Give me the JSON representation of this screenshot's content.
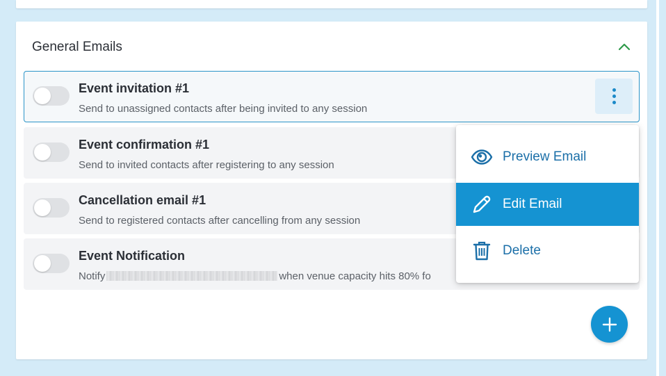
{
  "section": {
    "title": "General Emails"
  },
  "emails": [
    {
      "title": "Event invitation #1",
      "description": "Send to unassigned contacts after being invited to any session",
      "enabled": false
    },
    {
      "title": "Event confirmation #1",
      "description": "Send to invited contacts after registering to any session",
      "enabled": false
    },
    {
      "title": "Cancellation email #1",
      "description": "Send to registered contacts after cancelling from any session",
      "enabled": false
    },
    {
      "title": "Event Notification",
      "description_prefix": "Notify",
      "description_suffix": "when venue capacity hits 80% fo",
      "enabled": false
    }
  ],
  "menu": {
    "items": [
      {
        "label": "Preview Email",
        "icon": "eye-icon"
      },
      {
        "label": "Edit Email",
        "icon": "pencil-icon",
        "active": true
      },
      {
        "label": "Delete",
        "icon": "trash-icon"
      }
    ]
  },
  "icons": {
    "collapse": "chevron-up-icon",
    "row_menu": "kebab-menu-icon",
    "add": "plus-icon"
  },
  "colors": {
    "accent": "#1593d2",
    "link": "#1b6fa8",
    "chevron": "#2e9a4a",
    "background": "#d4ebf8",
    "row_background": "#f3f4f6"
  }
}
